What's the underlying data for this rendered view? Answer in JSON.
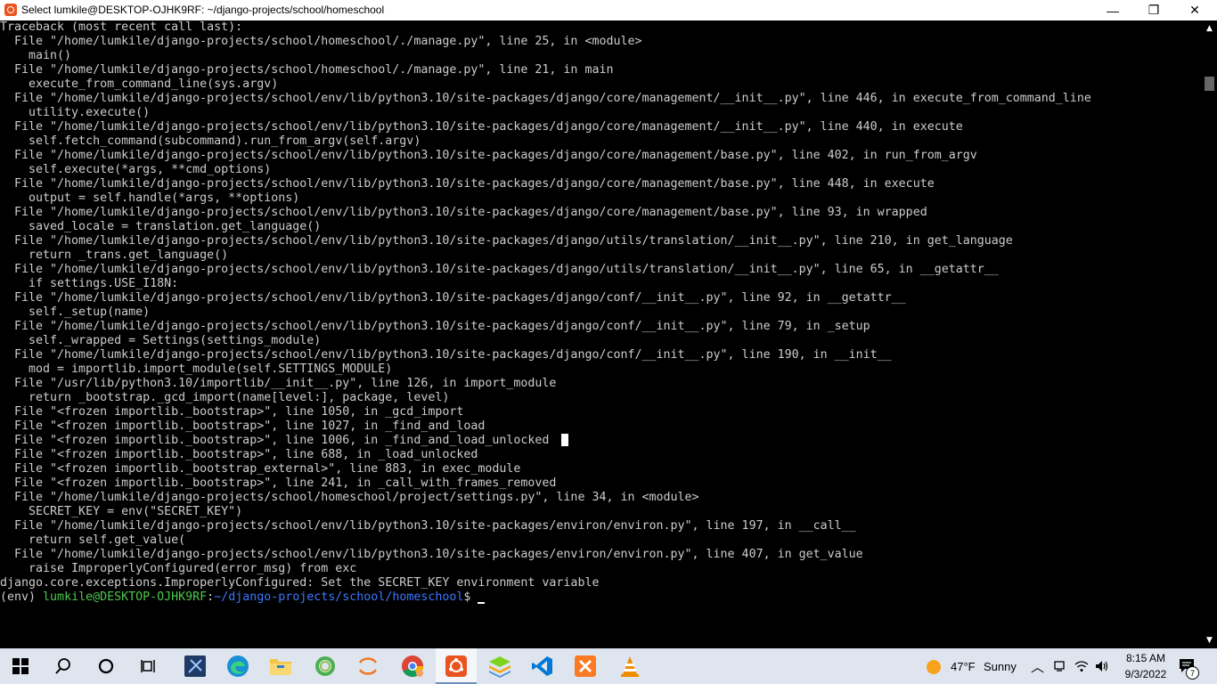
{
  "window": {
    "title": "Select lumkile@DESKTOP-OJHK9RF: ~/django-projects/school/homeschool",
    "minimize_symbol": "—",
    "restore_symbol": "❐",
    "close_symbol": "✕"
  },
  "terminal": {
    "lines": [
      "Traceback (most recent call last):",
      "  File \"/home/lumkile/django-projects/school/homeschool/./manage.py\", line 25, in <module>",
      "    main()",
      "  File \"/home/lumkile/django-projects/school/homeschool/./manage.py\", line 21, in main",
      "    execute_from_command_line(sys.argv)",
      "  File \"/home/lumkile/django-projects/school/env/lib/python3.10/site-packages/django/core/management/__init__.py\", line 446, in execute_from_command_line",
      "    utility.execute()",
      "  File \"/home/lumkile/django-projects/school/env/lib/python3.10/site-packages/django/core/management/__init__.py\", line 440, in execute",
      "    self.fetch_command(subcommand).run_from_argv(self.argv)",
      "  File \"/home/lumkile/django-projects/school/env/lib/python3.10/site-packages/django/core/management/base.py\", line 402, in run_from_argv",
      "    self.execute(*args, **cmd_options)",
      "  File \"/home/lumkile/django-projects/school/env/lib/python3.10/site-packages/django/core/management/base.py\", line 448, in execute",
      "    output = self.handle(*args, **options)",
      "  File \"/home/lumkile/django-projects/school/env/lib/python3.10/site-packages/django/core/management/base.py\", line 93, in wrapped",
      "    saved_locale = translation.get_language()",
      "  File \"/home/lumkile/django-projects/school/env/lib/python3.10/site-packages/django/utils/translation/__init__.py\", line 210, in get_language",
      "    return _trans.get_language()",
      "  File \"/home/lumkile/django-projects/school/env/lib/python3.10/site-packages/django/utils/translation/__init__.py\", line 65, in __getattr__",
      "    if settings.USE_I18N:",
      "  File \"/home/lumkile/django-projects/school/env/lib/python3.10/site-packages/django/conf/__init__.py\", line 92, in __getattr__",
      "    self._setup(name)",
      "  File \"/home/lumkile/django-projects/school/env/lib/python3.10/site-packages/django/conf/__init__.py\", line 79, in _setup",
      "    self._wrapped = Settings(settings_module)",
      "  File \"/home/lumkile/django-projects/school/env/lib/python3.10/site-packages/django/conf/__init__.py\", line 190, in __init__",
      "    mod = importlib.import_module(self.SETTINGS_MODULE)",
      "  File \"/usr/lib/python3.10/importlib/__init__.py\", line 126, in import_module",
      "    return _bootstrap._gcd_import(name[level:], package, level)",
      "  File \"<frozen importlib._bootstrap>\", line 1050, in _gcd_import",
      "  File \"<frozen importlib._bootstrap>\", line 1027, in _find_and_load",
      "  File \"<frozen importlib._bootstrap>\", line 1006, in _find_and_load_unlocked",
      "  File \"<frozen importlib._bootstrap>\", line 688, in _load_unlocked",
      "  File \"<frozen importlib._bootstrap_external>\", line 883, in exec_module",
      "  File \"<frozen importlib._bootstrap>\", line 241, in _call_with_frames_removed",
      "  File \"/home/lumkile/django-projects/school/homeschool/project/settings.py\", line 34, in <module>",
      "    SECRET_KEY = env(\"SECRET_KEY\")",
      "  File \"/home/lumkile/django-projects/school/env/lib/python3.10/site-packages/environ/environ.py\", line 197, in __call__",
      "    return self.get_value(",
      "  File \"/home/lumkile/django-projects/school/env/lib/python3.10/site-packages/environ/environ.py\", line 407, in get_value",
      "    raise ImproperlyConfigured(error_msg) from exc",
      "django.core.exceptions.ImproperlyConfigured: Set the SECRET_KEY environment variable"
    ],
    "selection_cursor_line": 29,
    "prompt": {
      "env": "(env) ",
      "user_host": "lumkile@DESKTOP-OJHK9RF",
      "sep": ":",
      "path": "~/django-projects/school/homeschool",
      "symbol": "$"
    },
    "colors": {
      "background": "#000000",
      "text": "#cccccc",
      "user_host": "#4ec94e",
      "path": "#3b78ff"
    }
  },
  "taskbar": {
    "apps": [
      {
        "name": "start-button",
        "icon": "windows-logo"
      },
      {
        "name": "search-button",
        "icon": "search"
      },
      {
        "name": "cortana-button",
        "icon": "circle"
      },
      {
        "name": "task-view-button",
        "icon": "task-view"
      },
      {
        "name": "taskbar-app-snipping",
        "icon": "snipping-tool"
      },
      {
        "name": "taskbar-app-edge",
        "icon": "edge"
      },
      {
        "name": "taskbar-app-file-explorer",
        "icon": "folder"
      },
      {
        "name": "taskbar-app-refresh",
        "icon": "green-ring"
      },
      {
        "name": "taskbar-app-jupyter",
        "icon": "jupyter"
      },
      {
        "name": "taskbar-app-chrome",
        "icon": "chrome"
      },
      {
        "name": "taskbar-app-ubuntu",
        "icon": "ubuntu"
      },
      {
        "name": "taskbar-app-bluestacks",
        "icon": "bluestacks"
      },
      {
        "name": "taskbar-app-vscode",
        "icon": "vscode"
      },
      {
        "name": "taskbar-app-xampp",
        "icon": "xampp"
      },
      {
        "name": "taskbar-app-vlc",
        "icon": "vlc"
      }
    ],
    "weather": {
      "temp": "47°F",
      "condition": "Sunny"
    },
    "clock": {
      "time": "8:15 AM",
      "date": "9/3/2022"
    },
    "notification_count": "7"
  }
}
